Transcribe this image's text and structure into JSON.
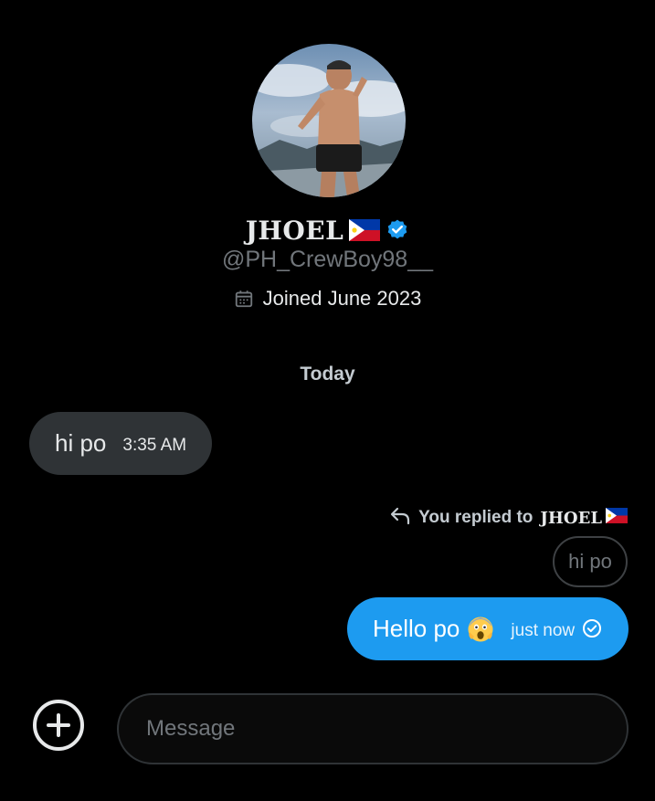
{
  "profile": {
    "name": "JHOEL",
    "handle": "@PH_CrewBoy98__",
    "joined": "Joined June 2023",
    "avatar_icon": "profile-photo",
    "flag_icon": "philippines-flag",
    "verified_icon": "verified-badge",
    "calendar_icon": "calendar-icon"
  },
  "conversation": {
    "day_separator": "Today",
    "messages": [
      {
        "direction": "incoming",
        "text": "hi po",
        "time": "3:35 AM"
      },
      {
        "direction": "outgoing",
        "reply_context": {
          "label": "You replied to",
          "name": "JHOEL",
          "quoted_text": "hi po"
        },
        "text": "Hello po",
        "emoji": "face-screaming-in-fear",
        "time": "just now",
        "status_icon": "sent-check-icon"
      }
    ]
  },
  "composer": {
    "placeholder": "Message",
    "add_icon": "plus-circle-icon"
  },
  "colors": {
    "background": "#000000",
    "incoming_bubble": "#2f3336",
    "outgoing_bubble": "#1d9bf0",
    "muted_text": "#71767b",
    "primary_text": "#e7e9ea",
    "verified": "#1d9bf0"
  }
}
